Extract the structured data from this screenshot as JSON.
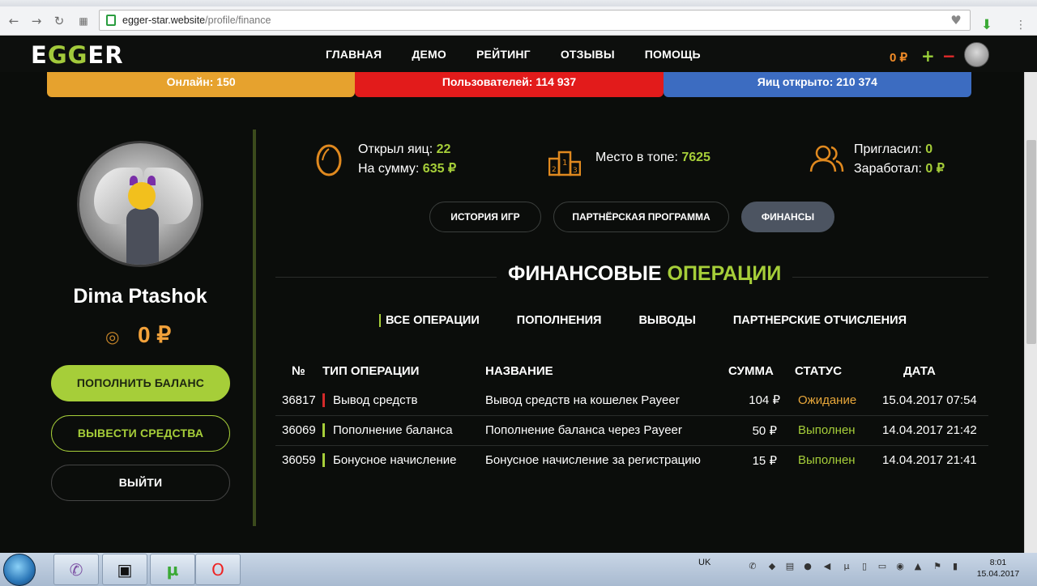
{
  "browser": {
    "url_host": "egger-star.website",
    "url_path": "/profile/finance"
  },
  "header": {
    "logo": {
      "part1": "E",
      "part2": "GG",
      "part3": "ER"
    },
    "menu": [
      "ГЛАВНАЯ",
      "ДЕМО",
      "РЕЙТИНГ",
      "ОТЗЫВЫ",
      "ПОМОЩЬ"
    ],
    "balance": "0 ₽",
    "plus": "+",
    "minus": "−"
  },
  "stats": {
    "online": "Онлайн: 150",
    "users": "Пользователей: 114 937",
    "eggs": "Яиц открыто: 210 374"
  },
  "profile": {
    "name": "Dima Ptashok",
    "balance": "0 ₽",
    "buttons": {
      "deposit": "ПОПОЛНИТЬ БАЛАНС",
      "withdraw": "ВЫВЕСТИ СРЕДСТВА",
      "logout": "ВЫЙТИ"
    }
  },
  "kpis": {
    "eggs_label": "Открыл яиц:",
    "eggs_value": "22",
    "sum_label": "На сумму:",
    "sum_value": "635 ₽",
    "rank_label": "Место в топе:",
    "rank_value": "7625",
    "invited_label": "Пригласил:",
    "invited_value": "0",
    "earned_label": "Заработал:",
    "earned_value": "0 ₽"
  },
  "tabs": [
    "ИСТОРИЯ ИГР",
    "ПАРТНЁРСКАЯ ПРОГРАММА",
    "ФИНАНСЫ"
  ],
  "section": {
    "title_main": "ФИНАНСОВЫЕ",
    "title_accent": "ОПЕРАЦИИ"
  },
  "subnav": [
    "ВСЕ ОПЕРАЦИИ",
    "ПОПОЛНЕНИЯ",
    "ВЫВОДЫ",
    "ПАРТНЕРСКИЕ ОТЧИСЛЕНИЯ"
  ],
  "table": {
    "headers": [
      "№",
      "ТИП ОПЕРАЦИИ",
      "НАЗВАНИЕ",
      "СУММА",
      "СТАТУС",
      "ДАТА"
    ],
    "rows": [
      {
        "num": "36817",
        "type": "Вывод средств",
        "name": "Вывод средств на кошелек Payeer",
        "sum": "104 ₽",
        "status": "Ожидание",
        "date": "15.04.2017 07:54"
      },
      {
        "num": "36069",
        "type": "Пополнение баланса",
        "name": "Пополнение баланса через Payeer",
        "sum": "50 ₽",
        "status": "Выполнен",
        "date": "14.04.2017 21:42"
      },
      {
        "num": "36059",
        "type": "Бонусное начисление",
        "name": "Бонусное начисление за регистрацию",
        "sum": "15 ₽",
        "status": "Выполнен",
        "date": "14.04.2017 21:41"
      }
    ]
  },
  "taskbar": {
    "lang": "UK",
    "time": "8:01",
    "date": "15.04.2017"
  },
  "colors": {
    "accent": "#a6ce39",
    "orange": "#f2a13a",
    "red": "#e21b1b",
    "blue": "#3c6cc1"
  }
}
